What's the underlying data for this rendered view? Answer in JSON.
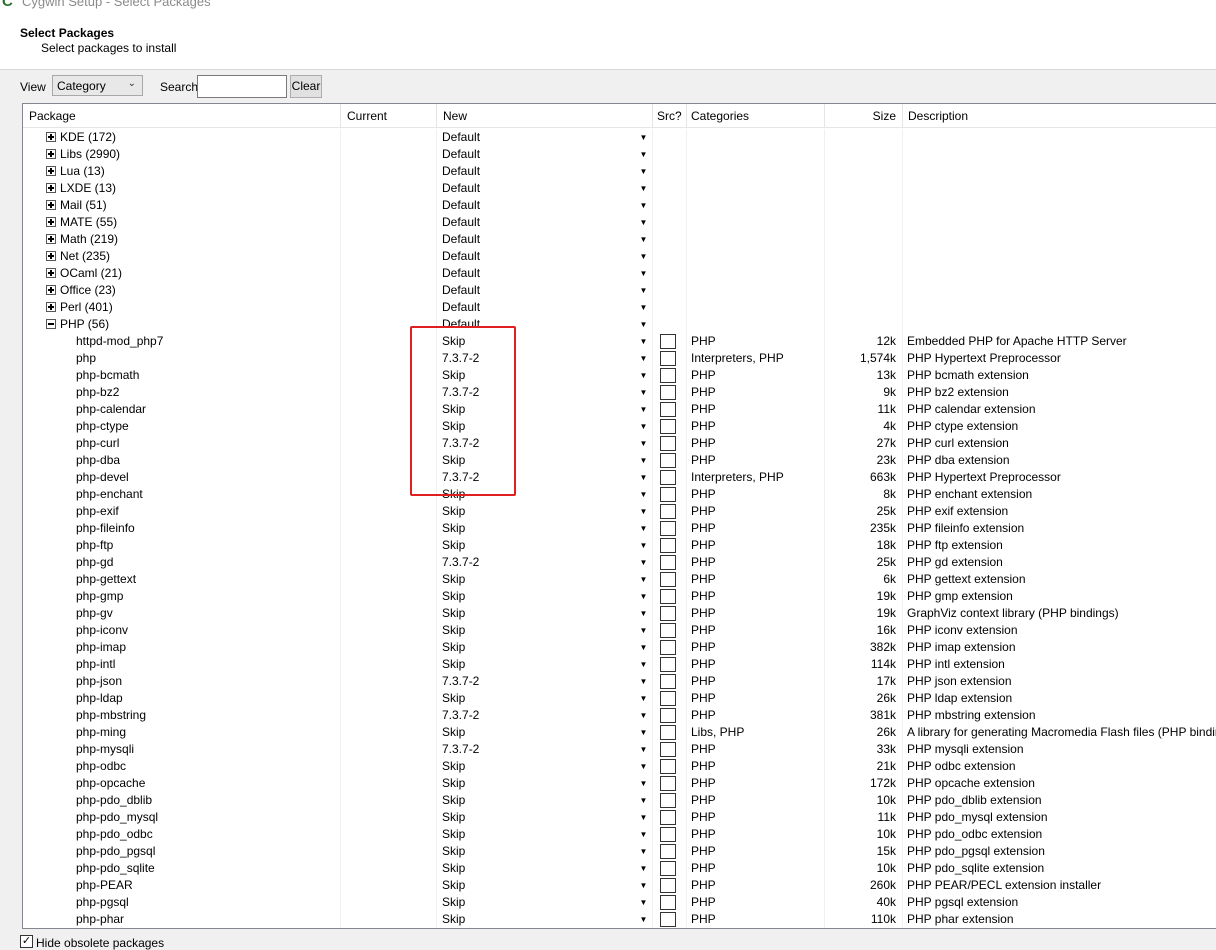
{
  "window": {
    "title": "Cygwin Setup - Select Packages"
  },
  "header": {
    "title": "Select Packages",
    "subtitle": "Select packages to install"
  },
  "toolbar": {
    "view_label": "View",
    "view_value": "Category",
    "search_label": "Search",
    "search_value": "",
    "clear_label": "Clear"
  },
  "columns": [
    "Package",
    "Current",
    "New",
    "Src?",
    "Categories",
    "Size",
    "Description"
  ],
  "categories": [
    {
      "name": "KDE (172)",
      "expanded": false,
      "new": "Default"
    },
    {
      "name": "Libs (2990)",
      "expanded": false,
      "new": "Default"
    },
    {
      "name": "Lua (13)",
      "expanded": false,
      "new": "Default"
    },
    {
      "name": "LXDE (13)",
      "expanded": false,
      "new": "Default"
    },
    {
      "name": "Mail (51)",
      "expanded": false,
      "new": "Default"
    },
    {
      "name": "MATE (55)",
      "expanded": false,
      "new": "Default"
    },
    {
      "name": "Math (219)",
      "expanded": false,
      "new": "Default"
    },
    {
      "name": "Net (235)",
      "expanded": false,
      "new": "Default"
    },
    {
      "name": "OCaml (21)",
      "expanded": false,
      "new": "Default"
    },
    {
      "name": "Office (23)",
      "expanded": false,
      "new": "Default"
    },
    {
      "name": "Perl (401)",
      "expanded": false,
      "new": "Default"
    },
    {
      "name": "PHP (56)",
      "expanded": true,
      "new": "Default"
    }
  ],
  "packages": [
    {
      "name": "httpd-mod_php7",
      "current": "",
      "new": "Skip",
      "categories": "PHP",
      "size": "12k",
      "description": "Embedded PHP for Apache HTTP Server"
    },
    {
      "name": "php",
      "current": "",
      "new": "7.3.7-2",
      "categories": "Interpreters, PHP",
      "size": "1,574k",
      "description": "PHP Hypertext Preprocessor"
    },
    {
      "name": "php-bcmath",
      "current": "",
      "new": "Skip",
      "categories": "PHP",
      "size": "13k",
      "description": "PHP bcmath extension"
    },
    {
      "name": "php-bz2",
      "current": "",
      "new": "7.3.7-2",
      "categories": "PHP",
      "size": "9k",
      "description": "PHP bz2 extension"
    },
    {
      "name": "php-calendar",
      "current": "",
      "new": "Skip",
      "categories": "PHP",
      "size": "11k",
      "description": "PHP calendar extension"
    },
    {
      "name": "php-ctype",
      "current": "",
      "new": "Skip",
      "categories": "PHP",
      "size": "4k",
      "description": "PHP ctype extension"
    },
    {
      "name": "php-curl",
      "current": "",
      "new": "7.3.7-2",
      "categories": "PHP",
      "size": "27k",
      "description": "PHP curl extension"
    },
    {
      "name": "php-dba",
      "current": "",
      "new": "Skip",
      "categories": "PHP",
      "size": "23k",
      "description": "PHP dba extension"
    },
    {
      "name": "php-devel",
      "current": "",
      "new": "7.3.7-2",
      "categories": "Interpreters, PHP",
      "size": "663k",
      "description": "PHP Hypertext Preprocessor"
    },
    {
      "name": "php-enchant",
      "current": "",
      "new": "Skip",
      "categories": "PHP",
      "size": "8k",
      "description": "PHP enchant extension"
    },
    {
      "name": "php-exif",
      "current": "",
      "new": "Skip",
      "categories": "PHP",
      "size": "25k",
      "description": "PHP exif extension"
    },
    {
      "name": "php-fileinfo",
      "current": "",
      "new": "Skip",
      "categories": "PHP",
      "size": "235k",
      "description": "PHP fileinfo extension"
    },
    {
      "name": "php-ftp",
      "current": "",
      "new": "Skip",
      "categories": "PHP",
      "size": "18k",
      "description": "PHP ftp extension"
    },
    {
      "name": "php-gd",
      "current": "",
      "new": "7.3.7-2",
      "categories": "PHP",
      "size": "25k",
      "description": "PHP gd extension"
    },
    {
      "name": "php-gettext",
      "current": "",
      "new": "Skip",
      "categories": "PHP",
      "size": "6k",
      "description": "PHP gettext extension"
    },
    {
      "name": "php-gmp",
      "current": "",
      "new": "Skip",
      "categories": "PHP",
      "size": "19k",
      "description": "PHP gmp extension"
    },
    {
      "name": "php-gv",
      "current": "",
      "new": "Skip",
      "categories": "PHP",
      "size": "19k",
      "description": "GraphViz context library (PHP bindings)"
    },
    {
      "name": "php-iconv",
      "current": "",
      "new": "Skip",
      "categories": "PHP",
      "size": "16k",
      "description": "PHP iconv extension"
    },
    {
      "name": "php-imap",
      "current": "",
      "new": "Skip",
      "categories": "PHP",
      "size": "382k",
      "description": "PHP imap extension"
    },
    {
      "name": "php-intl",
      "current": "",
      "new": "Skip",
      "categories": "PHP",
      "size": "114k",
      "description": "PHP intl extension"
    },
    {
      "name": "php-json",
      "current": "",
      "new": "7.3.7-2",
      "categories": "PHP",
      "size": "17k",
      "description": "PHP json extension"
    },
    {
      "name": "php-ldap",
      "current": "",
      "new": "Skip",
      "categories": "PHP",
      "size": "26k",
      "description": "PHP ldap extension"
    },
    {
      "name": "php-mbstring",
      "current": "",
      "new": "7.3.7-2",
      "categories": "PHP",
      "size": "381k",
      "description": "PHP mbstring extension"
    },
    {
      "name": "php-ming",
      "current": "",
      "new": "Skip",
      "categories": "Libs, PHP",
      "size": "26k",
      "description": "A library for generating Macromedia Flash files (PHP bindings)"
    },
    {
      "name": "php-mysqli",
      "current": "",
      "new": "7.3.7-2",
      "categories": "PHP",
      "size": "33k",
      "description": "PHP mysqli extension"
    },
    {
      "name": "php-odbc",
      "current": "",
      "new": "Skip",
      "categories": "PHP",
      "size": "21k",
      "description": "PHP odbc extension"
    },
    {
      "name": "php-opcache",
      "current": "",
      "new": "Skip",
      "categories": "PHP",
      "size": "172k",
      "description": "PHP opcache extension"
    },
    {
      "name": "php-pdo_dblib",
      "current": "",
      "new": "Skip",
      "categories": "PHP",
      "size": "10k",
      "description": "PHP pdo_dblib extension"
    },
    {
      "name": "php-pdo_mysql",
      "current": "",
      "new": "Skip",
      "categories": "PHP",
      "size": "11k",
      "description": "PHP pdo_mysql extension"
    },
    {
      "name": "php-pdo_odbc",
      "current": "",
      "new": "Skip",
      "categories": "PHP",
      "size": "10k",
      "description": "PHP pdo_odbc extension"
    },
    {
      "name": "php-pdo_pgsql",
      "current": "",
      "new": "Skip",
      "categories": "PHP",
      "size": "15k",
      "description": "PHP pdo_pgsql extension"
    },
    {
      "name": "php-pdo_sqlite",
      "current": "",
      "new": "Skip",
      "categories": "PHP",
      "size": "10k",
      "description": "PHP pdo_sqlite extension"
    },
    {
      "name": "php-PEAR",
      "current": "",
      "new": "Skip",
      "categories": "PHP",
      "size": "260k",
      "description": "PHP PEAR/PECL extension installer"
    },
    {
      "name": "php-pgsql",
      "current": "",
      "new": "Skip",
      "categories": "PHP",
      "size": "40k",
      "description": "PHP pgsql extension"
    },
    {
      "name": "php-phar",
      "current": "",
      "new": "Skip",
      "categories": "PHP",
      "size": "110k",
      "description": "PHP phar extension"
    }
  ],
  "footer": {
    "hide_obsolete_label": "Hide obsolete packages",
    "hide_obsolete_checked": true
  },
  "colors": {
    "highlight": "#e02020",
    "window_bg": "#f0f0f0"
  }
}
